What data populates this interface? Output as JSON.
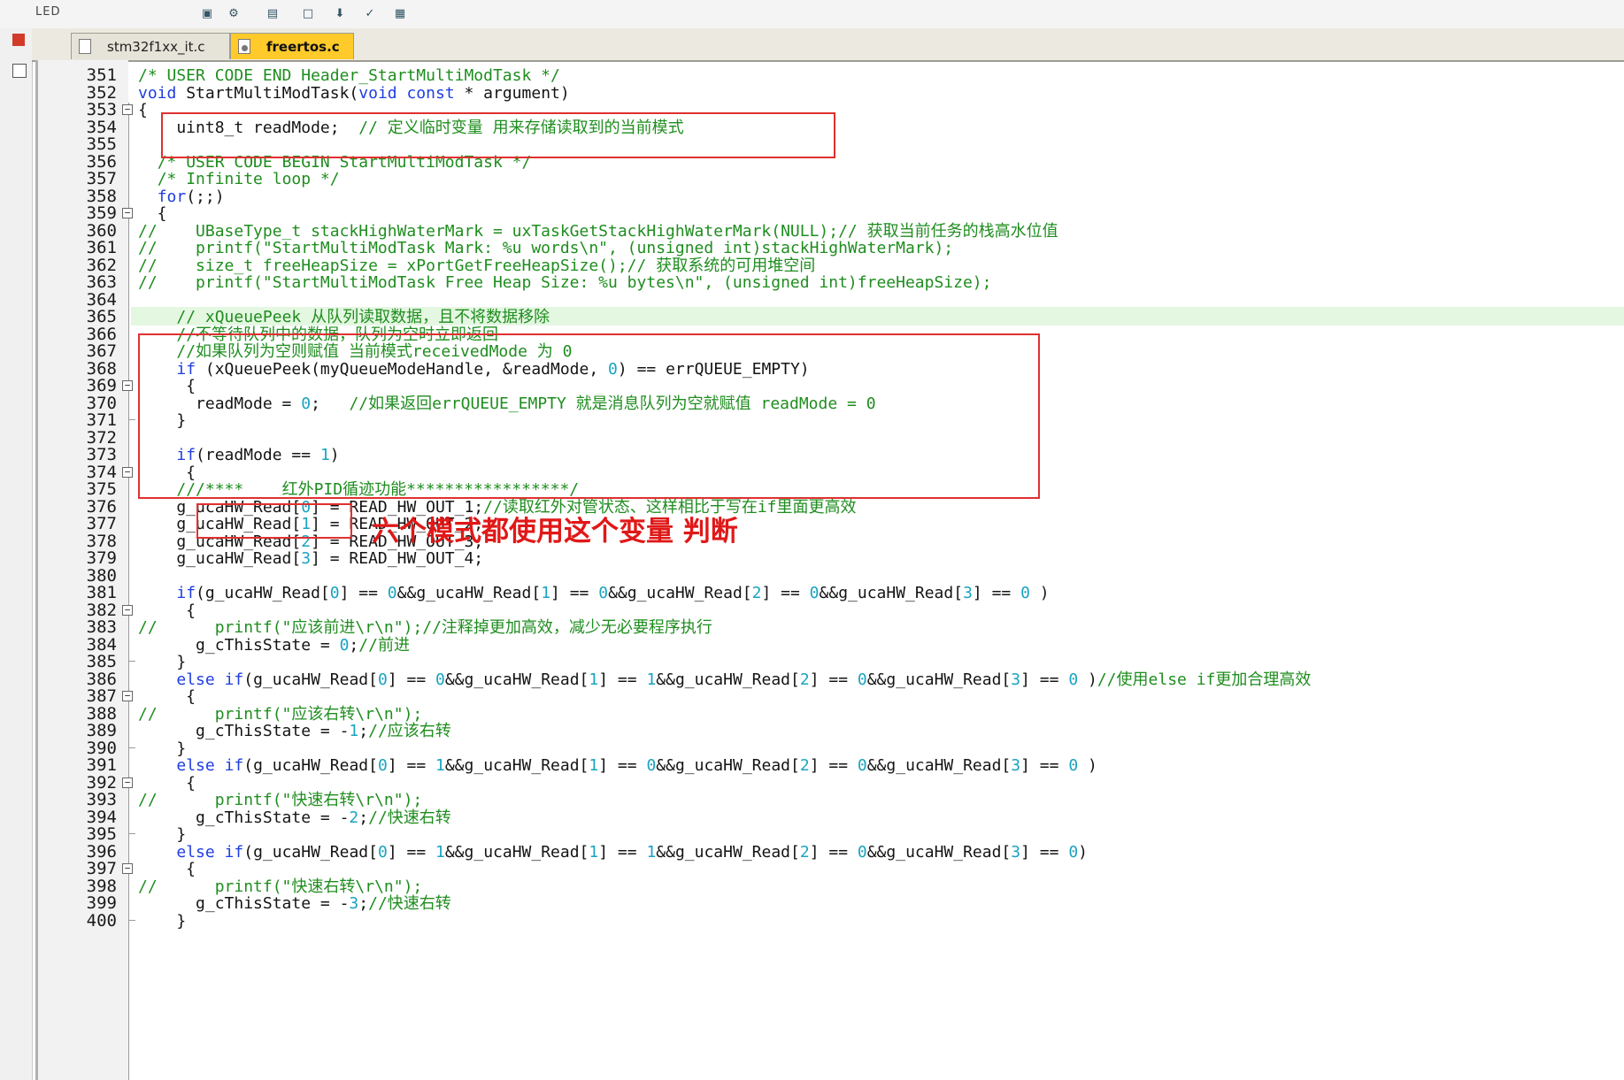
{
  "toolbar": {
    "label": "LED"
  },
  "tabs": [
    {
      "label": "stm32f1xx_it.c",
      "active": false
    },
    {
      "label": "freertos.c",
      "active": true
    }
  ],
  "colors": {
    "comment": "#1f8d1f",
    "keyword": "#1e3ee0",
    "number": "#1aa3c0",
    "annotation": "#e01818",
    "active_tab": "#ffca2a"
  },
  "annotation_text": "六个模式都使用这个变量 判断",
  "lines": [
    {
      "n": "351",
      "code": "/* USER CODE END Header_StartMultiModTask */"
    },
    {
      "n": "352",
      "code": "void StartMultiModTask(void const * argument)"
    },
    {
      "n": "353",
      "code": "{"
    },
    {
      "n": "354",
      "code": "    uint8_t readMode;  // 定义临时变量 用来存储读取到的当前模式"
    },
    {
      "n": "355",
      "code": ""
    },
    {
      "n": "356",
      "code": "  /* USER CODE BEGIN StartMultiModTask */"
    },
    {
      "n": "357",
      "code": "  /* Infinite loop */"
    },
    {
      "n": "358",
      "code": "  for(;;)"
    },
    {
      "n": "359",
      "code": "  {"
    },
    {
      "n": "360",
      "code": "//    UBaseType_t stackHighWaterMark = uxTaskGetStackHighWaterMark(NULL);// 获取当前任务的栈高水位值"
    },
    {
      "n": "361",
      "code": "//    printf(\"StartMultiModTask Mark: %u words\\n\", (unsigned int)stackHighWaterMark);"
    },
    {
      "n": "362",
      "code": "//    size_t freeHeapSize = xPortGetFreeHeapSize();// 获取系统的可用堆空间"
    },
    {
      "n": "363",
      "code": "//    printf(\"StartMultiModTask Free Heap Size: %u bytes\\n\", (unsigned int)freeHeapSize);"
    },
    {
      "n": "364",
      "code": ""
    },
    {
      "n": "365",
      "code": "    // xQueuePeek 从队列读取数据，且不将数据移除"
    },
    {
      "n": "366",
      "code": "    //不等待队列中的数据，队列为空时立即返回"
    },
    {
      "n": "367",
      "code": "    //如果队列为空则赋值 当前模式receivedMode 为 0"
    },
    {
      "n": "368",
      "code": "    if (xQueuePeek(myQueueModeHandle, &readMode, 0) == errQUEUE_EMPTY)"
    },
    {
      "n": "369",
      "code": "     {"
    },
    {
      "n": "370",
      "code": "      readMode = 0;   //如果返回errQUEUE_EMPTY 就是消息队列为空就赋值 readMode = 0"
    },
    {
      "n": "371",
      "code": "    }"
    },
    {
      "n": "372",
      "code": ""
    },
    {
      "n": "373",
      "code": "    if(readMode == 1)"
    },
    {
      "n": "374",
      "code": "     {"
    },
    {
      "n": "375",
      "code": "    ///****    红外PID循迹功能*****************/"
    },
    {
      "n": "376",
      "code": "    g_ucaHW_Read[0] = READ_HW_OUT_1;//读取红外对管状态、这样相比于写在if里面更高效"
    },
    {
      "n": "377",
      "code": "    g_ucaHW_Read[1] = READ_HW_OUT_2;"
    },
    {
      "n": "378",
      "code": "    g_ucaHW_Read[2] = READ_HW_OUT_3;"
    },
    {
      "n": "379",
      "code": "    g_ucaHW_Read[3] = READ_HW_OUT_4;"
    },
    {
      "n": "380",
      "code": ""
    },
    {
      "n": "381",
      "code": "    if(g_ucaHW_Read[0] == 0&&g_ucaHW_Read[1] == 0&&g_ucaHW_Read[2] == 0&&g_ucaHW_Read[3] == 0 )"
    },
    {
      "n": "382",
      "code": "     {"
    },
    {
      "n": "383",
      "code": "//      printf(\"应该前进\\r\\n\");//注释掉更加高效，减少无必要程序执行"
    },
    {
      "n": "384",
      "code": "      g_cThisState = 0;//前进"
    },
    {
      "n": "385",
      "code": "    }"
    },
    {
      "n": "386",
      "code": "    else if(g_ucaHW_Read[0] == 0&&g_ucaHW_Read[1] == 1&&g_ucaHW_Read[2] == 0&&g_ucaHW_Read[3] == 0 )//使用else if更加合理高效"
    },
    {
      "n": "387",
      "code": "     {"
    },
    {
      "n": "388",
      "code": "//      printf(\"应该右转\\r\\n\");"
    },
    {
      "n": "389",
      "code": "      g_cThisState = -1;//应该右转"
    },
    {
      "n": "390",
      "code": "    }"
    },
    {
      "n": "391",
      "code": "    else if(g_ucaHW_Read[0] == 1&&g_ucaHW_Read[1] == 0&&g_ucaHW_Read[2] == 0&&g_ucaHW_Read[3] == 0 )"
    },
    {
      "n": "392",
      "code": "     {"
    },
    {
      "n": "393",
      "code": "//      printf(\"快速右转\\r\\n\");"
    },
    {
      "n": "394",
      "code": "      g_cThisState = -2;//快速右转"
    },
    {
      "n": "395",
      "code": "    }"
    },
    {
      "n": "396",
      "code": "    else if(g_ucaHW_Read[0] == 1&&g_ucaHW_Read[1] == 1&&g_ucaHW_Read[2] == 0&&g_ucaHW_Read[3] == 0)"
    },
    {
      "n": "397",
      "code": "     {"
    },
    {
      "n": "398",
      "code": "//      printf(\"快速右转\\r\\n\");"
    },
    {
      "n": "399",
      "code": "      g_cThisState = -3;//快速右转"
    },
    {
      "n": "400",
      "code": "    }"
    }
  ]
}
